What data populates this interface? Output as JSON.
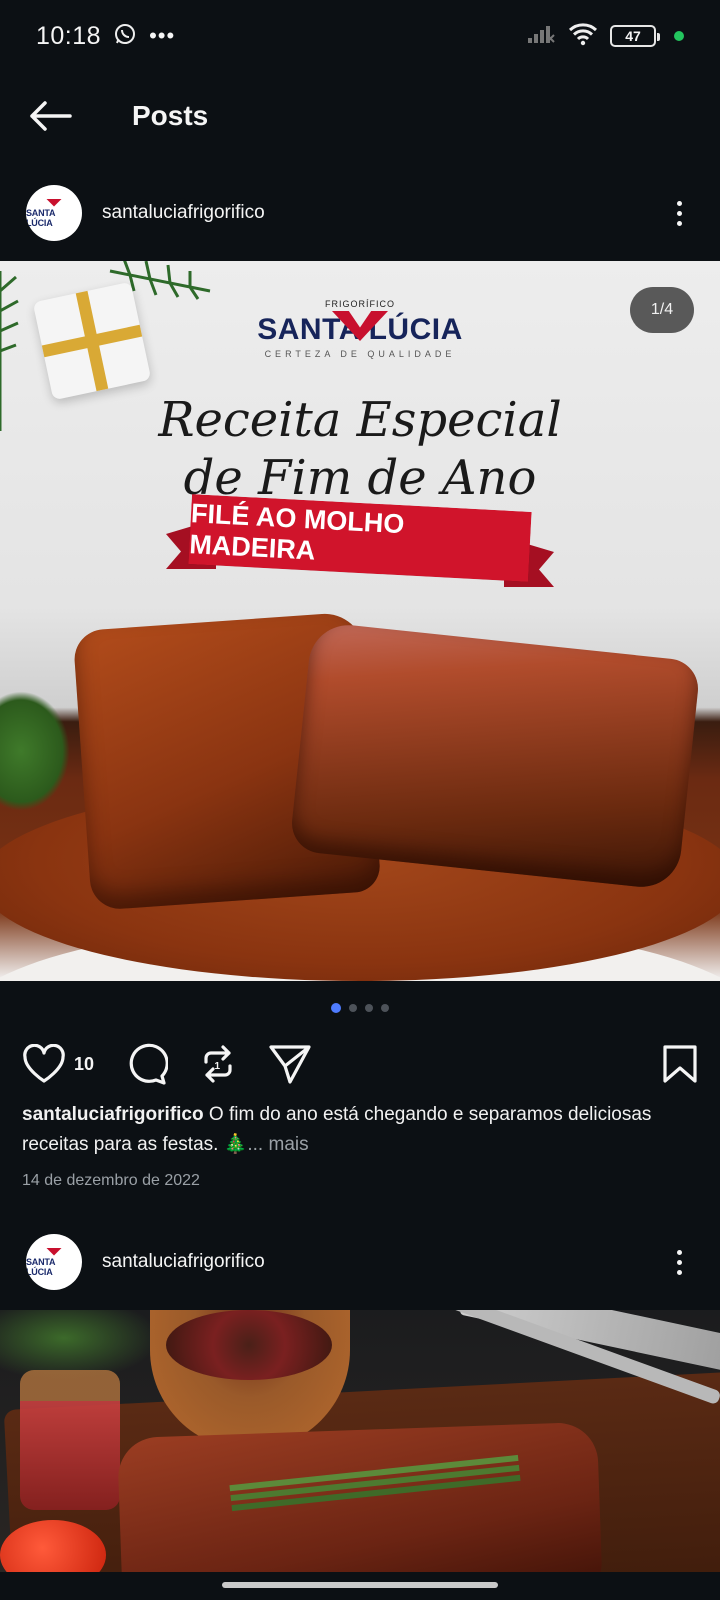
{
  "status_bar": {
    "time": "10:18",
    "battery": "47"
  },
  "header": {
    "title": "Posts"
  },
  "posts": [
    {
      "username": "santaluciafrigorifico",
      "avatar_text": "SANTA LÚCIA",
      "image": {
        "counter": "1/4",
        "brand_small": "FRIGORÍFICO",
        "brand_name": "SANTA LÚCIA",
        "brand_tagline": "CERTEZA DE QUALIDADE",
        "headline_1": "Receita Especial",
        "headline_2": "de Fim de Ano",
        "ribbon": "FILÉ AO MOLHO MADEIRA"
      },
      "carousel": {
        "total": 4,
        "active": 1
      },
      "likes": "10",
      "caption_user": "santaluciafrigorifico",
      "caption_text": "O fim do ano está chegando e separamos deliciosas receitas para as festas. 🎄",
      "caption_more": "... mais",
      "date": "14 de dezembro de 2022"
    },
    {
      "username": "santaluciafrigorifico",
      "avatar_text": "SANTA LÚCIA"
    }
  ],
  "colors": {
    "background": "#0c1014",
    "carousel_active": "#4f7cff",
    "brand_red": "#c8102e",
    "brand_navy": "#16245a"
  }
}
